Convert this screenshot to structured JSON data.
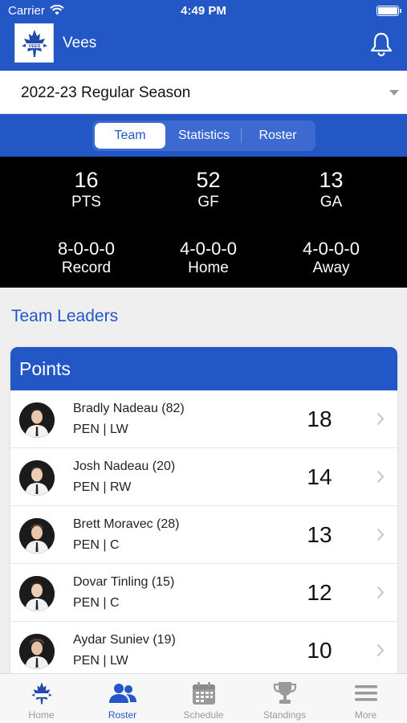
{
  "status_bar": {
    "carrier": "Carrier",
    "time": "4:49 PM"
  },
  "header": {
    "team_name": "Vees",
    "logo_icon": "maple-leaf-logo",
    "bell_icon": "bell-icon"
  },
  "season": {
    "selected": "2022-23 Regular Season"
  },
  "segments": {
    "team": "Team",
    "statistics": "Statistics",
    "roster": "Roster",
    "active": "Team"
  },
  "stats": [
    {
      "value": "16",
      "label": "PTS"
    },
    {
      "value": "52",
      "label": "GF"
    },
    {
      "value": "13",
      "label": "GA"
    },
    {
      "value": "8-0-0-0",
      "label": "Record"
    },
    {
      "value": "4-0-0-0",
      "label": "Home"
    },
    {
      "value": "4-0-0-0",
      "label": "Away"
    }
  ],
  "leaders": {
    "section_title": "Team Leaders",
    "card_title": "Points",
    "rows": [
      {
        "name": "Bradly Nadeau (82)",
        "position": "PEN | LW",
        "value": "18"
      },
      {
        "name": "Josh Nadeau (20)",
        "position": "PEN | RW",
        "value": "14"
      },
      {
        "name": "Brett Moravec (28)",
        "position": "PEN | C",
        "value": "13"
      },
      {
        "name": "Dovar Tinling (15)",
        "position": "PEN | C",
        "value": "12"
      },
      {
        "name": "Aydar Suniev (19)",
        "position": "PEN | LW",
        "value": "10"
      }
    ]
  },
  "tabs": [
    {
      "label": "Home",
      "icon": "team-logo-icon"
    },
    {
      "label": "Roster",
      "icon": "people-icon",
      "active": true
    },
    {
      "label": "Schedule",
      "icon": "calendar-icon"
    },
    {
      "label": "Standings",
      "icon": "trophy-icon"
    },
    {
      "label": "More",
      "icon": "menu-icon"
    }
  ],
  "colors": {
    "brand": "#2357c6",
    "stats_bg": "#000000",
    "inactive_tab": "#9a9a9a"
  }
}
